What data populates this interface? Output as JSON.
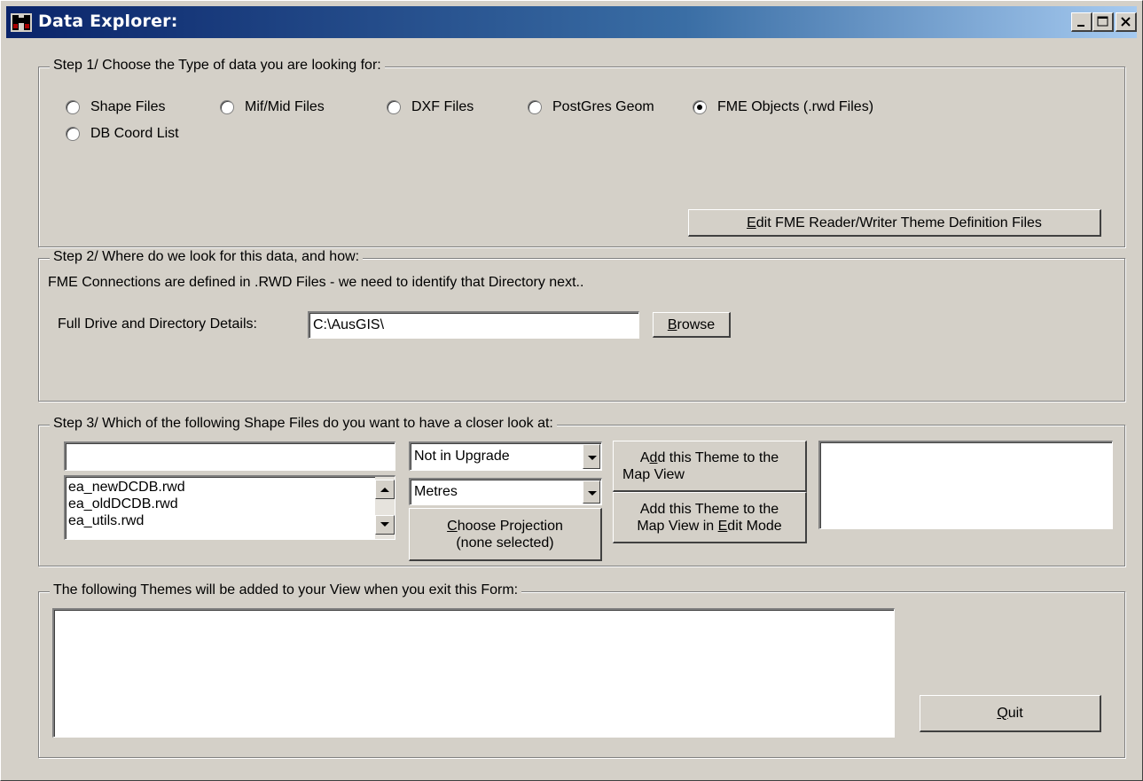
{
  "window": {
    "title": "Data Explorer:",
    "icon": "binoculars-icon"
  },
  "step1": {
    "legend": "Step 1/ Choose the Type of data you are looking for:",
    "options": [
      {
        "label": "Shape Files",
        "checked": false
      },
      {
        "label": "Mif/Mid Files",
        "checked": false
      },
      {
        "label": "DXF Files",
        "checked": false
      },
      {
        "label": "PostGres Geom",
        "checked": false
      },
      {
        "label": "FME Objects (.rwd Files)",
        "checked": true
      },
      {
        "label": "DB Coord List",
        "checked": false
      }
    ],
    "edit_button_prefix": "",
    "edit_button_mnemonic": "E",
    "edit_button_rest": "dit FME Reader/Writer Theme Definition Files"
  },
  "step2": {
    "legend": "Step 2/ Where do we look for this data, and how:",
    "description": "FME Connections are defined in .RWD Files - we need to identify that Directory next..",
    "dir_label": "Full Drive and Directory Details:",
    "dir_value": "C:\\AusGIS\\",
    "browse_mnemonic": "B",
    "browse_rest": "rowse"
  },
  "step3": {
    "legend": "Step 3/ Which of the following Shape Files do you want to have a closer look at:",
    "filter_value": "",
    "files": [
      "ea_newDCDB.rwd",
      "ea_oldDCDB.rwd",
      "ea_utils.rwd"
    ],
    "upgrade_selected": "Not in Upgrade",
    "units_selected": "Metres",
    "projection_mnemonic": "C",
    "projection_rest": "hoose Projection",
    "projection_status": "(none selected)",
    "add_theme_line1_pre": "A",
    "add_theme_line1_mn": "d",
    "add_theme_line1_post": "d this Theme to the",
    "add_theme_line2": "Map View",
    "add_edit_line1": "Add this Theme to the",
    "add_edit_line2_pre": "Map View in ",
    "add_edit_line2_mn": "E",
    "add_edit_line2_post": "dit Mode"
  },
  "step4": {
    "legend": "The following Themes will be added to your View when you exit this Form:",
    "quit_mnemonic": "Q",
    "quit_rest": "uit"
  }
}
